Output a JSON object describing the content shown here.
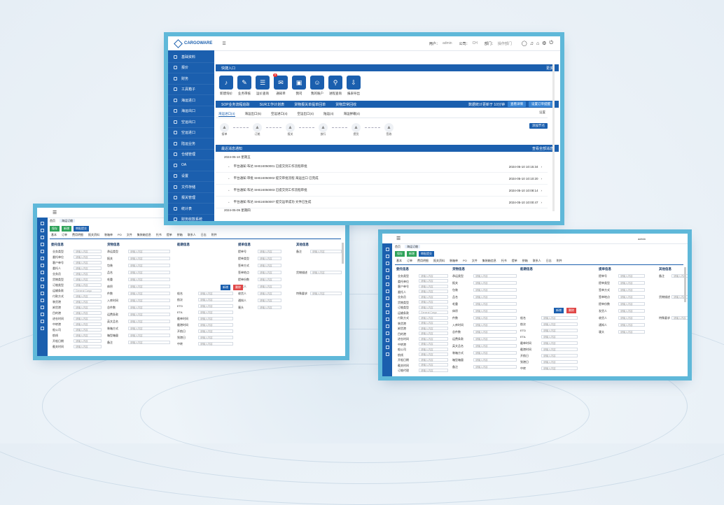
{
  "brand": {
    "logo": "CARGOWARE"
  },
  "main": {
    "topbar": {
      "user_label": "用户：",
      "user": "admin",
      "company_label": "公司：",
      "company": "CH",
      "branch_label": "部门：",
      "branch": "操作部门"
    },
    "sidebar": [
      "基础资料",
      "报价",
      "财务",
      "工具箱子",
      "海运进口",
      "海运出口",
      "空运出口",
      "空运进口",
      "陆运业务",
      "仓储管理",
      "OA",
      "设置",
      "文件存储",
      "报关管理",
      "统计表",
      "财务收款系统"
    ],
    "quick": {
      "title": "快捷入口",
      "more": "更多",
      "items": [
        "新建询价",
        "业务审核",
        "运价查询",
        "通知单",
        "我司",
        "我的账户",
        "进程查询",
        "报表导出"
      ],
      "badge": "8"
    },
    "tracking": {
      "tabs": [
        "SOP业务流程追踪",
        "SUR工作计划表",
        "货物报关单提单回单",
        "货物异常回收"
      ],
      "right": "数据统计更新于 10分钟",
      "btn1": "查看详情",
      "btn2": "设置订单提醒"
    },
    "flow": {
      "tabs": [
        "海运进口(4)",
        "海运出口(5)",
        "空运进口(4)",
        "空运出口(4)",
        "陆运(4)",
        "海运拼箱(4)"
      ],
      "steps": [
        "接单",
        "订舱",
        "报关",
        "放行",
        "提货",
        "签收"
      ],
      "settings": "设置",
      "btn": "添加节点"
    },
    "messages": {
      "title": "最近消息通知",
      "more": "查看全部消息",
      "date1": "2024-05-10 星期五",
      "date2": "2024-05-09 星期四",
      "items": [
        {
          "text": "平台通知 布达 SHE24050001 已提交到工作流程审批",
          "time": "2024-05-10 10:15:34"
        },
        {
          "text": "平台通知 审批 SHE24050002 提交审批流程 海运出口 已完成",
          "time": "2024-05-10 10:10:20"
        },
        {
          "text": "平台通知 布达 SHE24050003 已提交到工作流程审批",
          "time": "2024-05-10 10:08:14"
        },
        {
          "text": "平台通知 布达 SHE24050007 提交运单成功 文件已生成",
          "time": "2024-05-10 10:00:47"
        }
      ]
    }
  },
  "form": {
    "tabs": [
      "首页",
      "海运订舱"
    ],
    "actions": [
      "保存",
      "新增",
      "审批提交"
    ],
    "subtabs": [
      "基本",
      "订单",
      "费用明细",
      "报关资料",
      "装箱单",
      "PO",
      "文件",
      "集装箱信息",
      "托书",
      "提单",
      "拼箱",
      "联系人",
      "日志",
      "附件"
    ],
    "sections": [
      "委托信息",
      "货物信息",
      "船期信息",
      "提单信息",
      "其他信息"
    ],
    "labels_a": [
      "业务类型",
      "委托单位",
      "客户单号",
      "委托人",
      "业务员",
      "货物类型",
      "订舱类型",
      "运输条款",
      "付款方式",
      "装货港",
      "卸货港",
      "目的港",
      "进仓时间",
      "中转港",
      "船公司",
      "航线",
      "开船日期",
      "截关时间",
      "订舱代理"
    ],
    "labels_b": [
      "承运类型",
      "报关",
      "包装",
      "品名",
      "毛重",
      "体积",
      "件数",
      "入库时间",
      "总件数",
      "运费条款",
      "英文品名",
      "装箱方式",
      "箱型箱量",
      "备注"
    ],
    "labels_c": [
      "船名",
      "航次",
      "ETD",
      "ETA",
      "截单时间",
      "截港时间",
      "开航日",
      "到港日",
      "中转"
    ],
    "labels_d": [
      "提单号",
      "提单类型",
      "签单方式",
      "签单地点",
      "提单份数",
      "发货人",
      "收货人",
      "通知人",
      "唛头"
    ],
    "labels_e": [
      "备注",
      "货物描述",
      "特殊要求"
    ],
    "values": {
      "cargo": "General Cargo",
      "placeholder": "请输入内容",
      "bl_type": "上海中心库",
      "yes": "是",
      "no": "否",
      "add": "新增",
      "del": "删除",
      "copy": "复制",
      "ctrl": "托单",
      "zero": "0",
      "none": "无数据"
    }
  }
}
